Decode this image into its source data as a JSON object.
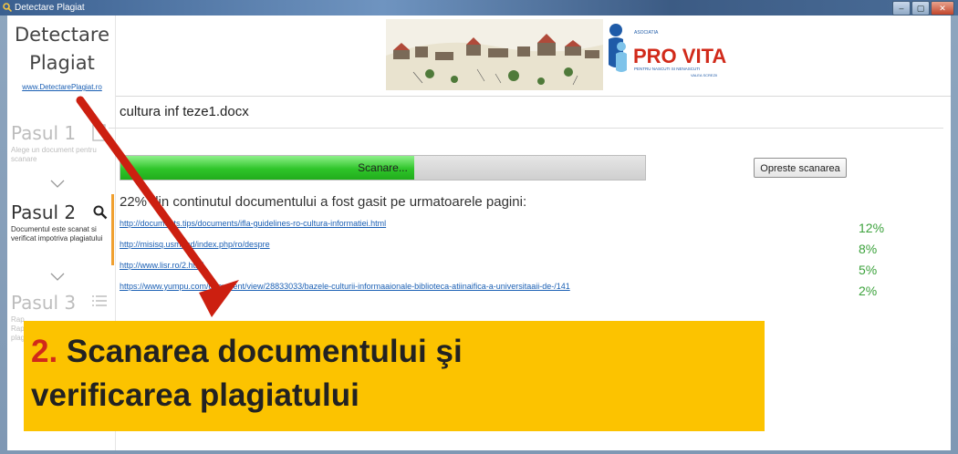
{
  "window": {
    "title": "Detectare Plagiat",
    "controls": [
      "–",
      "▢",
      "✕"
    ]
  },
  "sidebar": {
    "brand_line1": "Detectare",
    "brand_line2": "Plagiat",
    "brand_link": "www.DetectarePlagiat.ro",
    "steps": [
      {
        "title": "Pasul 1",
        "desc": "Alege un document pentru scanare",
        "icon": "document-icon",
        "active": false
      },
      {
        "title": "Pasul 2",
        "desc": "Documentul este scanat si verificat impotriva plagiatului",
        "icon": "search-icon",
        "active": true
      },
      {
        "title": "Pasul 3",
        "desc": "Rap Rap plag",
        "icon": "list-icon",
        "active": false
      }
    ]
  },
  "header": {
    "banner_icon": "village-banner-image",
    "logo_icon": "pro-vita-logo",
    "logo_text": "PRO VITA"
  },
  "main": {
    "document_name": "cultura inf teze1.docx",
    "progress_label": "Scanare...",
    "progress_fraction": 0.56,
    "stop_button_label": "Opreste scanarea",
    "summary": "22% din continutul documentului a fost gasit pe urmatoarele pagini:",
    "results": [
      {
        "url": "http://documents.tips/documents/ifla-guidelines-ro-cultura-informatiei.html",
        "percent": "12%"
      },
      {
        "url": "http://misisq.usm.md/index.php/ro/despre",
        "percent": "8%"
      },
      {
        "url": "http://www.lisr.ro/2.html",
        "percent": "5%"
      },
      {
        "url": "https://www.yumpu.com/document/view/28833033/bazele-culturii-informaaionale-biblioteca-atiinaifica-a-universitaaii-de-/141",
        "percent": "2%"
      }
    ]
  },
  "annotation": {
    "number": "2.",
    "line1": " Scanarea documentului şi",
    "line2": "verificarea plagiatului",
    "background_color": "#fcc300",
    "number_color": "#d12a1a",
    "arrow_color": "#cc1f10"
  }
}
